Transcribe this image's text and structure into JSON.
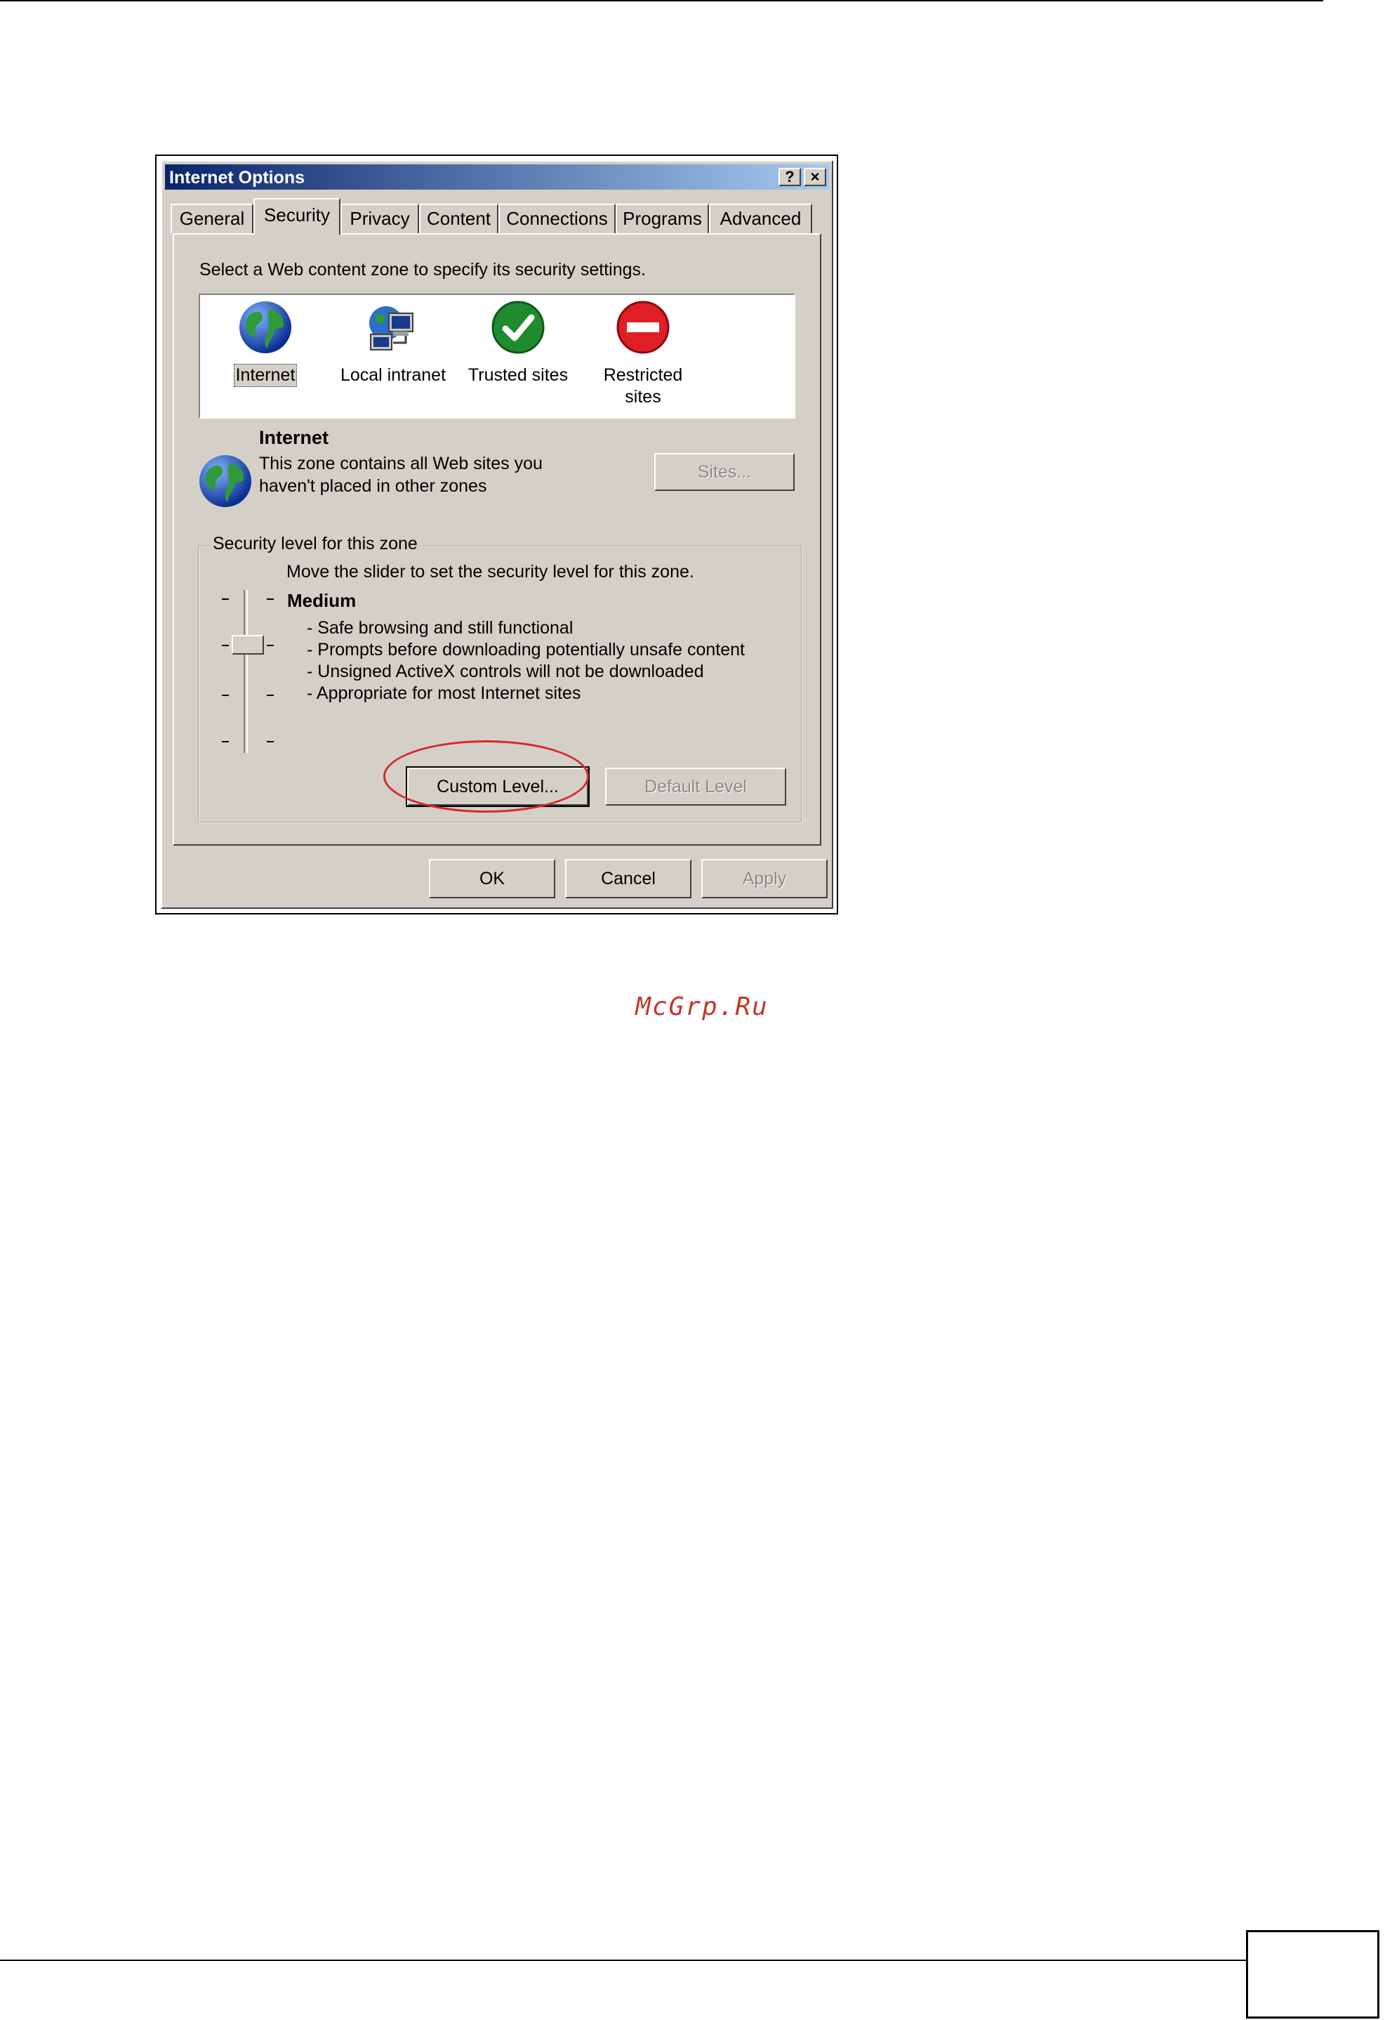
{
  "dialog": {
    "title": "Internet Options",
    "help_glyph": "?",
    "close_glyph": "×"
  },
  "tabs": [
    {
      "label": "General"
    },
    {
      "label": "Security",
      "active": true
    },
    {
      "label": "Privacy"
    },
    {
      "label": "Content"
    },
    {
      "label": "Connections"
    },
    {
      "label": "Programs"
    },
    {
      "label": "Advanced"
    }
  ],
  "security": {
    "instruction": "Select a Web content zone to specify its security settings.",
    "zones": [
      {
        "label": "Internet",
        "icon": "globe-icon",
        "selected": true
      },
      {
        "label": "Local intranet",
        "icon": "local-intranet-icon"
      },
      {
        "label": "Trusted sites",
        "icon": "trusted-check-icon"
      },
      {
        "label_line1": "Restricted",
        "label_line2": "sites",
        "icon": "restricted-icon"
      }
    ],
    "zone_info": {
      "title": "Internet",
      "desc_line1": "This zone contains all Web sites you",
      "desc_line2": "haven't placed in other zones",
      "sites_button": "Sites..."
    },
    "level_group": {
      "legend": "Security level for this zone",
      "instruction": "Move the slider to set the security level for this zone.",
      "level_name": "Medium",
      "details": [
        "- Safe browsing and still functional",
        "- Prompts before downloading potentially unsafe content",
        "- Unsigned ActiveX controls will not be downloaded",
        "- Appropriate for most Internet sites"
      ],
      "slider_ticks": 4,
      "slider_level_index": 1,
      "custom_level_button": "Custom Level...",
      "default_level_button": "Default Level"
    }
  },
  "footer": {
    "ok": "OK",
    "cancel": "Cancel",
    "apply": "Apply"
  },
  "watermark": "McGrp.Ru",
  "colors": {
    "dialog_face": "#d4d0c8",
    "title_gradient_start": "#0a246a",
    "title_gradient_end": "#a6caf0",
    "highlight_oval": "#d8272a",
    "watermark": "#c0392b"
  }
}
